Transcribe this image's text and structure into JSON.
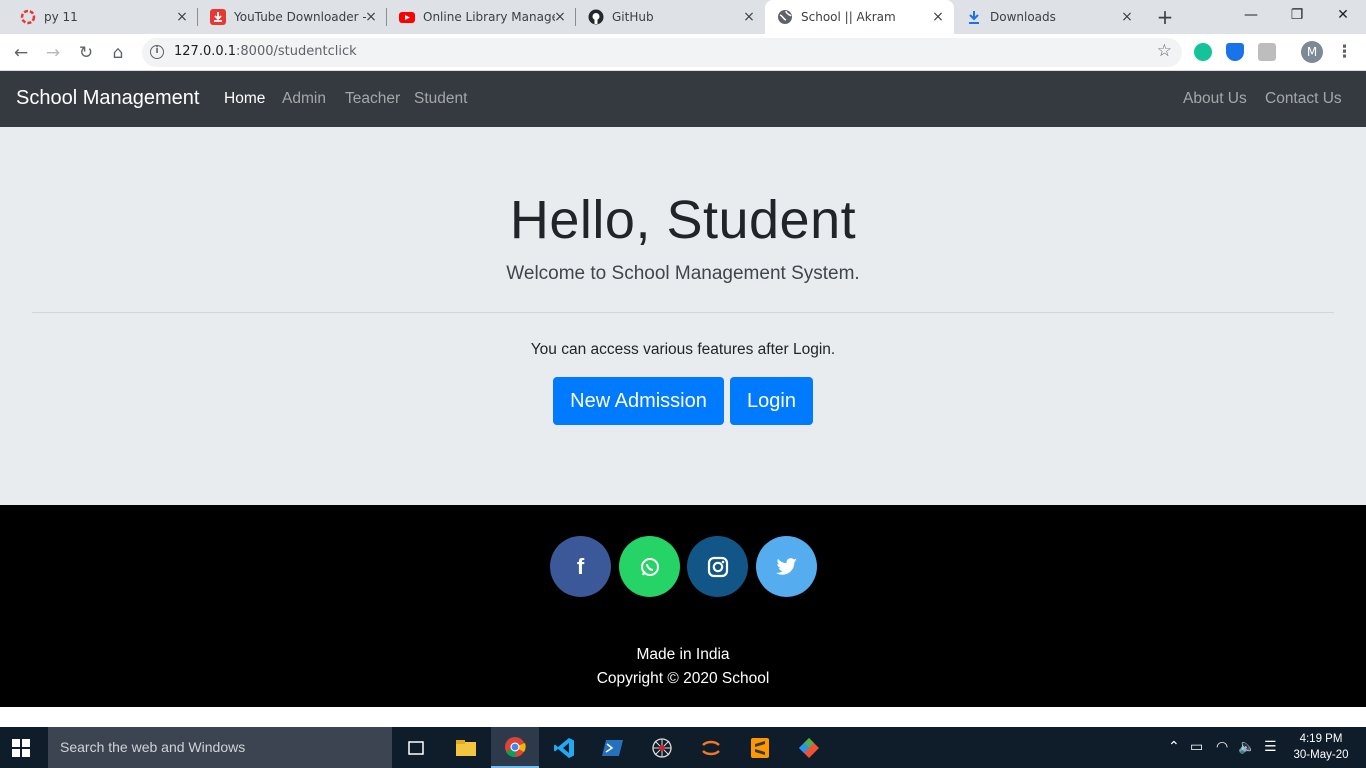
{
  "browser": {
    "tabs": [
      {
        "title": "py 11",
        "icon": "ring-icon"
      },
      {
        "title": "YouTube Downloader - ",
        "icon": "download-app-icon"
      },
      {
        "title": "Online Library Manage",
        "icon": "youtube-icon"
      },
      {
        "title": "GitHub",
        "icon": "github-icon"
      },
      {
        "title": "School || Akram",
        "icon": "globe-icon",
        "active": true
      },
      {
        "title": "Downloads",
        "icon": "download-icon"
      }
    ],
    "close_glyph": "×",
    "new_tab_glyph": "+",
    "window_controls": {
      "minimize": "—",
      "maximize": "❐",
      "close": "✕"
    },
    "url_host": "127.0.0.1",
    "url_rest": ":8000/studentclick",
    "profile_initial": "M",
    "info_glyph": "i"
  },
  "navbar": {
    "brand": "School Management",
    "links": [
      "Home",
      "Admin",
      "Teacher",
      "Student"
    ],
    "active_link": "Home",
    "right_links": [
      "About Us",
      "Contact Us"
    ]
  },
  "hero": {
    "title": "Hello, Student",
    "subtitle": "Welcome to School Management System.",
    "text": "You can access various features after Login.",
    "buttons": [
      "New Admission",
      "Login"
    ]
  },
  "footer": {
    "social": [
      {
        "name": "facebook",
        "glyph": "f",
        "color": "#3b5998"
      },
      {
        "name": "whatsapp",
        "glyph": "✆",
        "color": "#25d366"
      },
      {
        "name": "instagram",
        "glyph": "◎",
        "color": "#125688"
      },
      {
        "name": "twitter",
        "glyph": "🐦",
        "color": "#55acee"
      }
    ],
    "made_in": "Made in India",
    "copyright": "Copyright © 2020 School"
  },
  "taskbar": {
    "search_placeholder": "Search the web and Windows",
    "time": "4:19 PM",
    "date": "30-May-20"
  },
  "colors": {
    "primary": "#007bff",
    "navbar": "#343a40",
    "jumbotron": "#e9ecef"
  }
}
